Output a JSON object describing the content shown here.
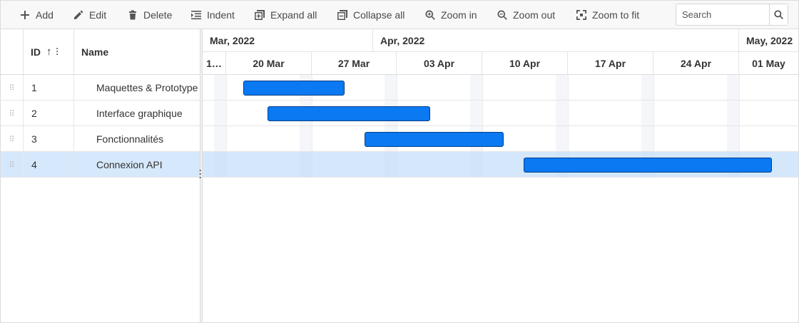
{
  "toolbar": {
    "add_label": "Add",
    "edit_label": "Edit",
    "delete_label": "Delete",
    "indent_label": "Indent",
    "expand_all_label": "Expand all",
    "collapse_all_label": "Collapse all",
    "zoom_in_label": "Zoom in",
    "zoom_out_label": "Zoom out",
    "zoom_to_fit_label": "Zoom to fit",
    "search_placeholder": "Search"
  },
  "grid": {
    "columns": {
      "id": "ID",
      "name": "Name"
    },
    "sort_indicator": "↑",
    "rows": [
      {
        "id": "1",
        "name": "Maquettes & Prototype",
        "selected": false
      },
      {
        "id": "2",
        "name": "Interface graphique",
        "selected": false
      },
      {
        "id": "3",
        "name": "Fonctionnalités",
        "selected": false
      },
      {
        "id": "4",
        "name": "Connexion API",
        "selected": true
      }
    ]
  },
  "timeline": {
    "months": [
      "Mar, 2022",
      "Apr, 2022",
      "May, 2022"
    ],
    "weeks": [
      "1…",
      "20 Mar",
      "27 Mar",
      "03 Apr",
      "10 Apr",
      "17 Apr",
      "24 Apr",
      "01 May"
    ]
  },
  "colors": {
    "bar_fill": "#0a79f2",
    "bar_border": "#063f8a",
    "selected_row": "#d6e8fb",
    "toolbar_bg": "#f8f8f8"
  },
  "icons": {
    "add": "plus-icon",
    "edit": "pencil-icon",
    "delete": "trash-icon",
    "indent": "indent-icon",
    "expand_all": "expand-all-icon",
    "collapse_all": "collapse-all-icon",
    "zoom_in": "zoom-in-icon",
    "zoom_out": "zoom-out-icon",
    "zoom_to_fit": "zoom-fit-icon",
    "search": "search-icon"
  }
}
